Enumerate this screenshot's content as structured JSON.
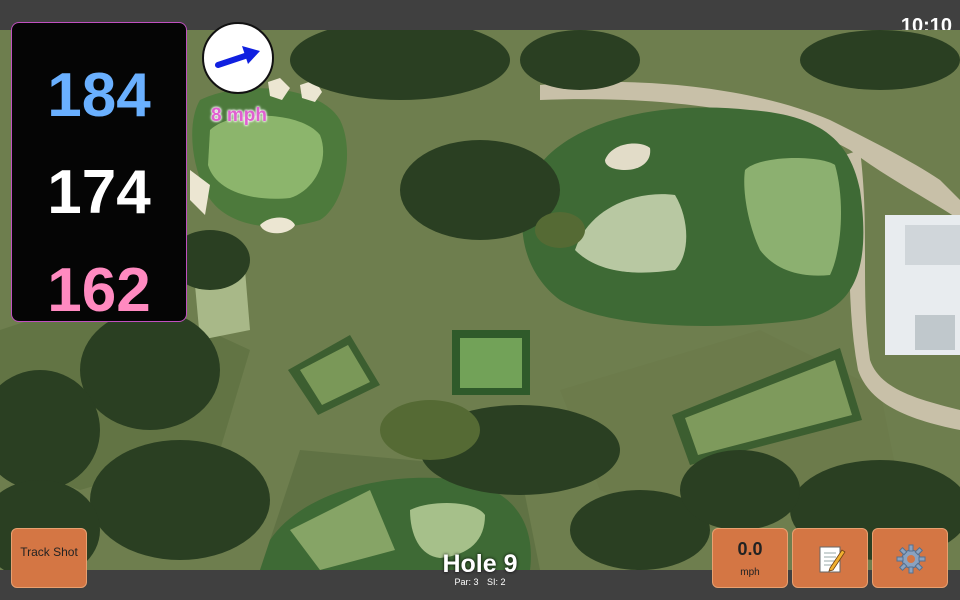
{
  "status_bar": {
    "time": "10:10"
  },
  "distances": {
    "back": "184",
    "center": "174",
    "front": "162"
  },
  "wind": {
    "speed_label": "8 mph",
    "icon": "wind-arrow-icon"
  },
  "buttons": {
    "track_shot_label": "Track Shot",
    "speed_value": "0.0",
    "speed_unit": "mph",
    "notes_icon": "notepad-icon",
    "settings_icon": "gear-icon"
  },
  "hole": {
    "title": "Hole 9",
    "par": "Par: 3",
    "si": "SI: 2"
  },
  "colors": {
    "back": "#6ab0ff",
    "center": "#ffffff",
    "front": "#ff8ac0",
    "button": "#d47644",
    "wind_text": "#e060d0"
  }
}
